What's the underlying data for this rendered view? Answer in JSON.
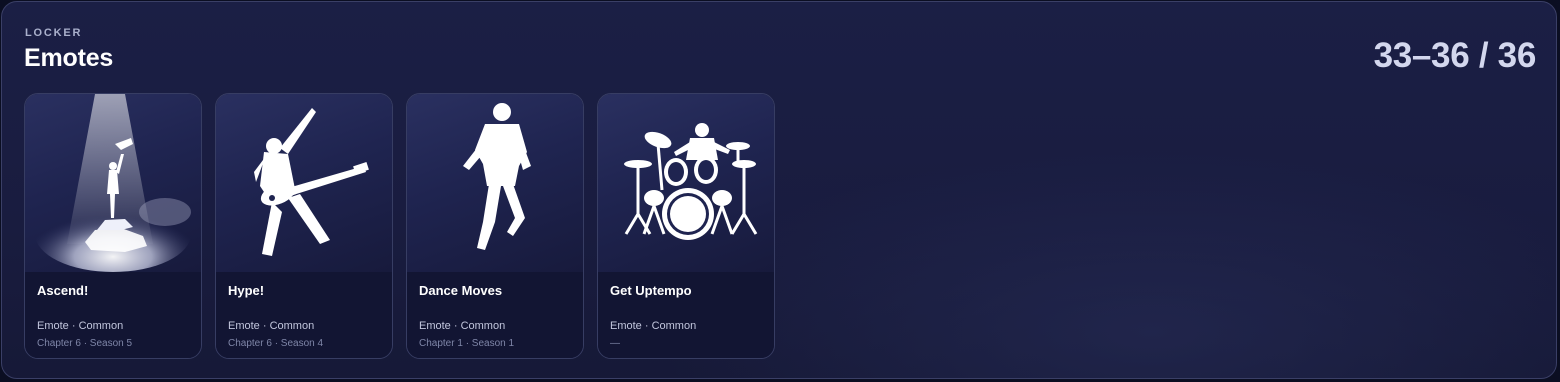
{
  "header": {
    "kicker": "LOCKER",
    "title": "Emotes",
    "counter": "33–36 / 36"
  },
  "cards": [
    {
      "name": "Ascend!",
      "meta": "Emote · Common",
      "season": "Chapter 6 · Season 5",
      "icon": "ascend-silhouette-icon"
    },
    {
      "name": "Hype!",
      "meta": "Emote · Common",
      "season": "Chapter 6 · Season 4",
      "icon": "guitar-player-silhouette-icon"
    },
    {
      "name": "Dance Moves",
      "meta": "Emote · Common",
      "season": "Chapter 1 · Season 1",
      "icon": "dancer-silhouette-icon"
    },
    {
      "name": "Get Uptempo",
      "meta": "Emote · Common",
      "season": "—",
      "icon": "drummer-silhouette-icon"
    }
  ],
  "colors": {
    "background": "#191c3f",
    "card_border": "#373d63",
    "text_primary": "#ffffff",
    "text_muted": "#7f86a8",
    "counter": "#d3d7ee"
  }
}
